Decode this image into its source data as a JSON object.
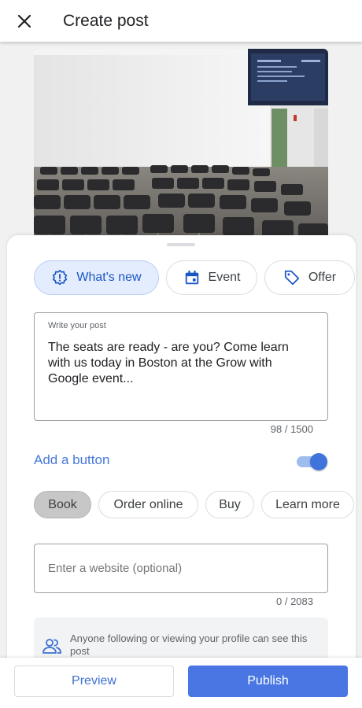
{
  "header": {
    "title": "Create post",
    "close_icon": "close-icon"
  },
  "post_types": [
    {
      "label": "What's new",
      "icon": "whats-new-icon",
      "selected": true
    },
    {
      "label": "Event",
      "icon": "calendar-icon",
      "selected": false
    },
    {
      "label": "Offer",
      "icon": "tag-icon",
      "selected": false
    }
  ],
  "post": {
    "label": "Write your post",
    "text": "The seats are ready - are you? Come learn with us today in Boston at the Grow with Google event...",
    "counter": "98 / 1500"
  },
  "add_button": {
    "label": "Add a button",
    "enabled": true
  },
  "action_buttons": [
    {
      "label": "Book",
      "selected": true
    },
    {
      "label": "Order online",
      "selected": false
    },
    {
      "label": "Buy",
      "selected": false
    },
    {
      "label": "Learn more",
      "selected": false
    }
  ],
  "website": {
    "placeholder": "Enter a website (optional)",
    "value": "",
    "counter": "0 / 2083"
  },
  "info": {
    "text": "Anyone following or viewing your profile can see this post",
    "icon": "people-icon"
  },
  "footer": {
    "preview_label": "Preview",
    "publish_label": "Publish"
  },
  "colors": {
    "accent": "#4a76e3",
    "selected_chip_bg": "#e4edfd",
    "link": "#4678d8"
  }
}
